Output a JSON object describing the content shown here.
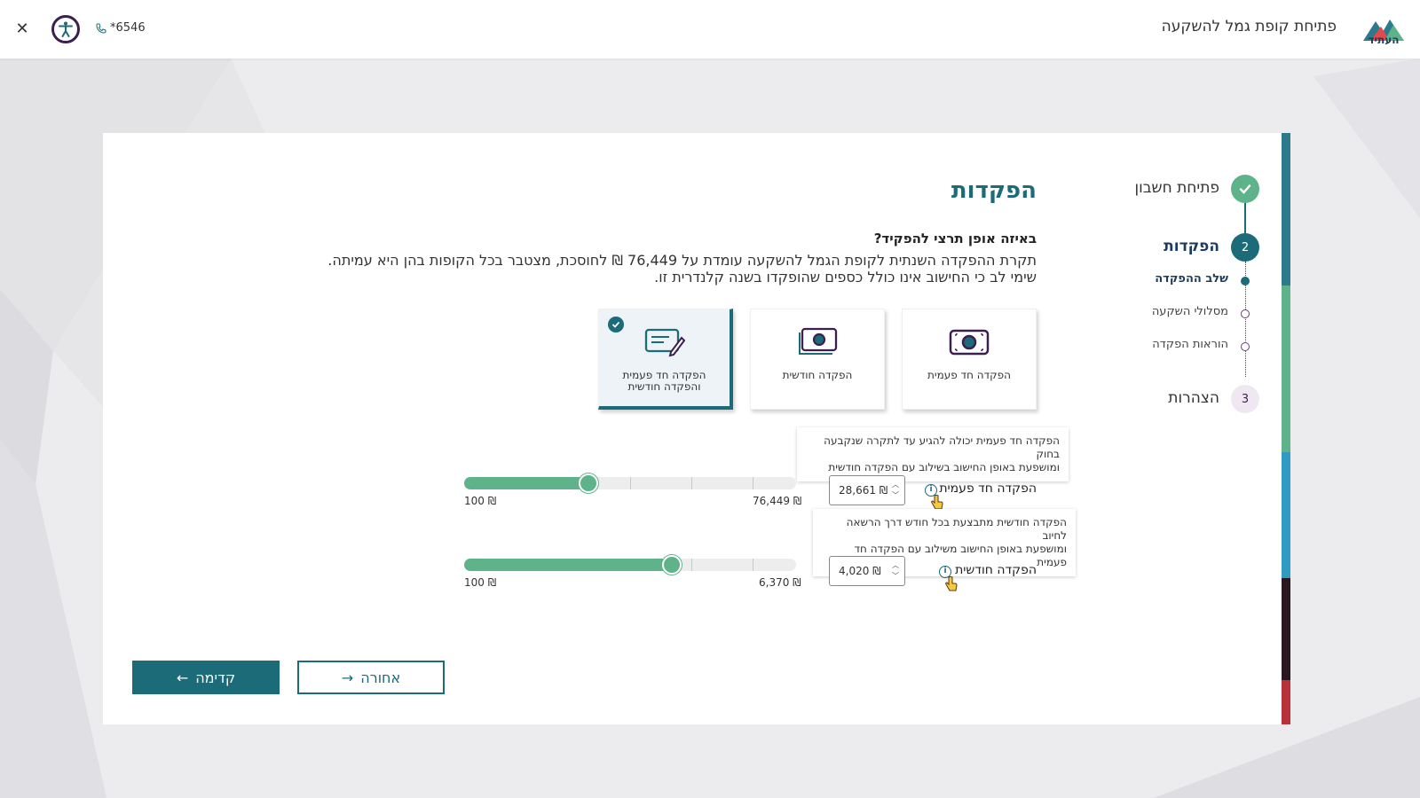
{
  "header": {
    "logo_text": "העתיד",
    "title": "פתיחת קופת גמל להשקעה",
    "phone": "*6546",
    "close_icon": "close-icon",
    "accessibility_icon": "accessibility-icon"
  },
  "steps": {
    "items": [
      {
        "label": "פתיחת חשבון",
        "status": "done"
      },
      {
        "label": "הפקדות",
        "number": "2",
        "status": "current"
      },
      {
        "label": "הצהרות",
        "number": "3",
        "status": "pending"
      }
    ],
    "substeps": [
      {
        "label": "שלב ההפקדה",
        "status": "active"
      },
      {
        "label": "מסלולי השקעה",
        "status": "pending"
      },
      {
        "label": "הוראות הפקדה",
        "status": "pending"
      }
    ]
  },
  "main": {
    "title": "הפקדות",
    "question": "באיזה אופן תרצי להפקיד?",
    "desc_line1": "תקרת ההפקדה השנתית לקופת הגמל להשקעה עומדת על 76,449 ₪ לחוסכת, מצטבר בכל הקופות בהן היא עמיתה.",
    "desc_line2": "שימי לב כי החישוב אינו כולל כספים שהופקדו בשנה קלנדרית זו.",
    "options": [
      {
        "label": "הפקדה חד פעמית",
        "icon": "cash-icon",
        "selected": false
      },
      {
        "label": "הפקדה חודשית",
        "icon": "cash-stack-icon",
        "selected": false
      },
      {
        "label_line1": "הפקדה חד פעמית",
        "label_line2": "והפקדה חודשית",
        "icon": "document-pen-icon",
        "selected": true
      }
    ],
    "one_time": {
      "label": "הפקדה חד פעמית",
      "tooltip_line1": "הפקדה חד פעמית יכולה להגיע עד לתקרה שנקבעה בחוק",
      "tooltip_line2": "ומושפעת באופן החישוב בשילוב עם הפקדה חודשית",
      "value": "28,661 ₪",
      "min_label": "100 ₪",
      "max_label": "76,449 ₪",
      "min": 100,
      "max": 76449,
      "current": 28661
    },
    "monthly": {
      "label": "הפקדה חודשית",
      "tooltip_line1": "הפקדה חודשית מתבצעת בכל חודש דרך הרשאה לחיוב",
      "tooltip_line2": "ומושפעת באופן החישוב משילוב עם הפקדה חד פעמית",
      "value": "4,020 ₪",
      "min_label": "100 ₪",
      "max_label": "6,370 ₪",
      "min": 100,
      "max": 6370,
      "current": 4020
    },
    "next_label": "קדימה",
    "back_label": "אחורה"
  },
  "colors": {
    "accent": "#1b6b78",
    "slider": "#5fb38a",
    "purple": "#3a1f4f"
  }
}
